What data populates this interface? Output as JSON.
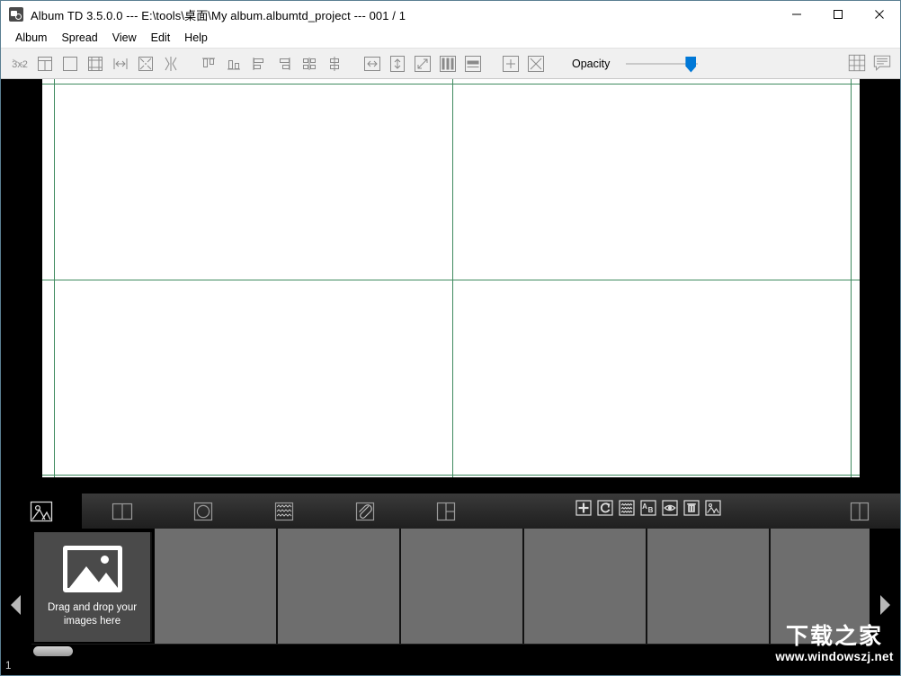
{
  "window": {
    "title": "Album TD 3.5.0.0 --- E:\\tools\\桌面\\My album.albumtd_project --- 001 / 1",
    "app_icon": "album-app-icon",
    "controls": {
      "minimize": "minimize-icon",
      "maximize": "maximize-icon",
      "close": "close-icon"
    }
  },
  "menubar": {
    "items": [
      {
        "label": "Album"
      },
      {
        "label": "Spread"
      },
      {
        "label": "View"
      },
      {
        "label": "Edit"
      },
      {
        "label": "Help"
      }
    ]
  },
  "toolbar": {
    "group1": [
      {
        "name": "grid-3x2-icon",
        "label": "3x2"
      },
      {
        "name": "frame-top-divider-icon",
        "label": ""
      },
      {
        "name": "frame-empty-icon",
        "label": ""
      },
      {
        "name": "frame-margins-icon",
        "label": ""
      },
      {
        "name": "fit-width-icon",
        "label": ""
      },
      {
        "name": "shrink-center-icon",
        "label": ""
      },
      {
        "name": "mirror-horizontal-icon",
        "label": ""
      }
    ],
    "group2": [
      {
        "name": "align-top-icon",
        "label": ""
      },
      {
        "name": "align-bottom-icon",
        "label": ""
      },
      {
        "name": "align-left-icon",
        "label": ""
      },
      {
        "name": "align-right-icon",
        "label": ""
      },
      {
        "name": "distribute-horizontal-icon",
        "label": ""
      },
      {
        "name": "distribute-vertical-icon",
        "label": ""
      }
    ],
    "group3": [
      {
        "name": "stretch-horizontal-icon",
        "label": ""
      },
      {
        "name": "stretch-vertical-icon",
        "label": ""
      },
      {
        "name": "stretch-diagonal-icon",
        "label": ""
      },
      {
        "name": "columns-icon",
        "label": ""
      },
      {
        "name": "rows-icon",
        "label": ""
      }
    ],
    "group4": [
      {
        "name": "add-frame-icon",
        "label": ""
      },
      {
        "name": "remove-frame-icon",
        "label": ""
      }
    ],
    "opacity": {
      "label": "Opacity",
      "value": 100,
      "min": 0,
      "max": 100
    },
    "right_icons": [
      {
        "name": "grid-view-icon",
        "label": ""
      },
      {
        "name": "notes-panel-icon",
        "label": ""
      }
    ]
  },
  "canvas": {
    "page_background": "#ffffff",
    "guide_color": "#3f8a5f",
    "guides": {
      "vertical": [
        59,
        502,
        945
      ],
      "horizontal": [
        92,
        310,
        527
      ]
    }
  },
  "bottom_tabs": [
    {
      "name": "tab-images",
      "icon": "photo-icon",
      "active": true
    },
    {
      "name": "tab-spreads",
      "icon": "book-spread-icon",
      "active": false
    },
    {
      "name": "tab-masks",
      "icon": "circle-mask-icon",
      "active": false
    },
    {
      "name": "tab-textures",
      "icon": "texture-waves-icon",
      "active": false
    },
    {
      "name": "tab-clipart",
      "icon": "paperclip-icon",
      "active": false
    },
    {
      "name": "tab-layouts",
      "icon": "layout-split-icon",
      "active": false
    },
    {
      "name": "tab-templates",
      "icon": "two-page-icon",
      "active": false
    }
  ],
  "action_icons": [
    {
      "name": "add-image-icon"
    },
    {
      "name": "rotate-refresh-icon"
    },
    {
      "name": "texture-icon"
    },
    {
      "name": "sort-ab-icon"
    },
    {
      "name": "preview-eye-icon"
    },
    {
      "name": "delete-trash-icon"
    },
    {
      "name": "image-properties-icon"
    }
  ],
  "thumbnail_strip": {
    "dropzone": {
      "icon": "image-placeholder-icon",
      "text": "Drag and drop your images here"
    },
    "empty_cells": 6,
    "prev_arrow": "chevron-left-icon",
    "next_arrow": "chevron-right-icon"
  },
  "statusbar": {
    "text": "1"
  },
  "watermark": {
    "chinese": "下载之家",
    "url": "www.windowszj.net"
  }
}
